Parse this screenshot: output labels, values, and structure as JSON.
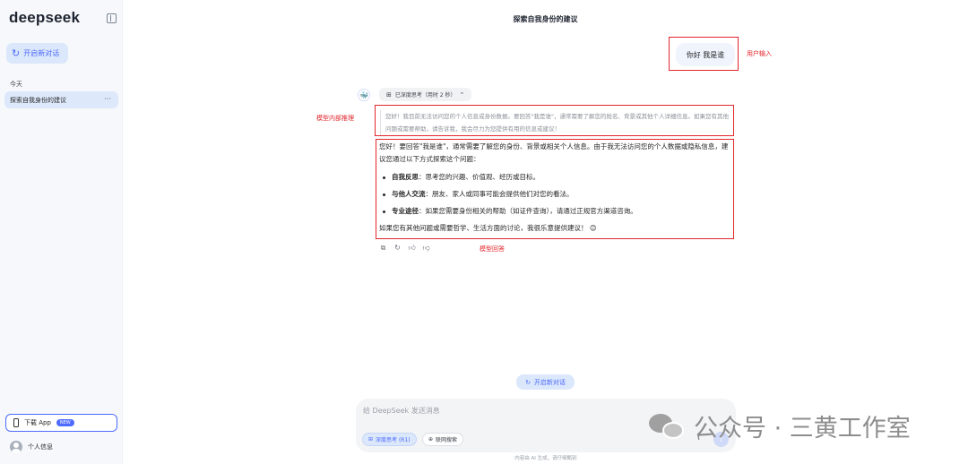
{
  "sidebar": {
    "logo": "deepseek",
    "new_chat": "开启新对话",
    "section_today": "今天",
    "history": [
      {
        "label": "探索自我身份的建议",
        "more": "···"
      }
    ],
    "download_app": "下载 App",
    "download_badge": "NEW",
    "profile": "个人信息"
  },
  "conversation": {
    "title": "探索自我身份的建议",
    "user_message": "你好 我是谁",
    "think_chip": "已深度思考（用时 2 秒）",
    "reasoning": "您好！我目前无法访问您的个人信息或身份数据。要回答\"我是谁\"，通常需要了解您的姓名、背景或其他个人详细信息。如果您有其他问题或需要帮助，请告诉我，我会尽力为您提供有用的信息或建议！",
    "answer": {
      "intro": "您好！要回答\"我是谁\"，通常需要了解您的身份、背景或相关个人信息。由于我无法访问您的个人数据或隐私信息，建议您通过以下方式探索这个问题：",
      "items": [
        {
          "title": "自我反思",
          "text": "：思考您的兴趣、价值观、经历或目标。"
        },
        {
          "title": "与他人交流",
          "text": "：朋友、家人或同事可能会提供他们对您的看法。"
        },
        {
          "title": "专业途径",
          "text": "：如果您需要身份相关的帮助（如证件查询），请通过正规官方渠道咨询。"
        }
      ],
      "outro": "如果您有其他问题或需要哲学、生活方面的讨论，我很乐意提供建议！ 😊"
    }
  },
  "annotations": {
    "user_input": "用户输入",
    "reasoning": "模型内部推理",
    "answer": "模型回答"
  },
  "composer": {
    "new_chat": "开启新对话",
    "placeholder": "给 DeepSeek 发送消息",
    "deep_think": "深度思考 (R1)",
    "web_search": "联网搜索",
    "footer": "内容由 AI 生成，请仔细甄别"
  },
  "watermark": "公众号 · 三黄工作室",
  "colors": {
    "accent": "#4d6bfe",
    "annotation": "#e3262b"
  }
}
